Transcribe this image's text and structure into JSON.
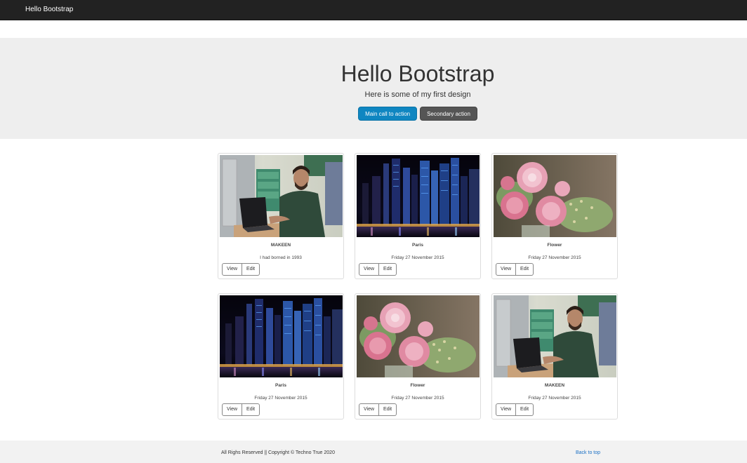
{
  "navbar": {
    "brand": "Hello Bootstrap"
  },
  "jumbotron": {
    "title": "Hello Bootstrap",
    "lead": "Here is some of my first design",
    "primary_button": "Main call to action",
    "secondary_button": "Secondary action"
  },
  "cards": [
    {
      "image": "man-with-laptop-photo",
      "title": "MAKEEN",
      "text": "I had borned in 1993",
      "view": "View",
      "edit": "Edit"
    },
    {
      "image": "night-city-skyline-photo",
      "title": "Paris",
      "text": "Friday 27 November 2015",
      "view": "View",
      "edit": "Edit"
    },
    {
      "image": "pink-flowers-bouquet-photo",
      "title": "Flower",
      "text": "Friday 27 November 2015",
      "view": "View",
      "edit": "Edit"
    },
    {
      "image": "night-city-skyline-photo",
      "title": "Paris",
      "text": "Friday 27 November 2015",
      "view": "View",
      "edit": "Edit"
    },
    {
      "image": "pink-flowers-bouquet-photo",
      "title": "Flower",
      "text": "Friday 27 November 2015",
      "view": "View",
      "edit": "Edit"
    },
    {
      "image": "man-with-laptop-photo",
      "title": "MAKEEN",
      "text": "Friday 27 November 2015",
      "view": "View",
      "edit": "Edit"
    }
  ],
  "footer": {
    "copyright": "All Righs Reserved || Copyright © Techno True 2020",
    "back_to_top": "Back to top"
  },
  "colors": {
    "navbar": "#222222",
    "jumbotron": "#eeeeee",
    "primary": "#0f86c1",
    "secondary": "#555555",
    "link": "#1a6fc4"
  }
}
